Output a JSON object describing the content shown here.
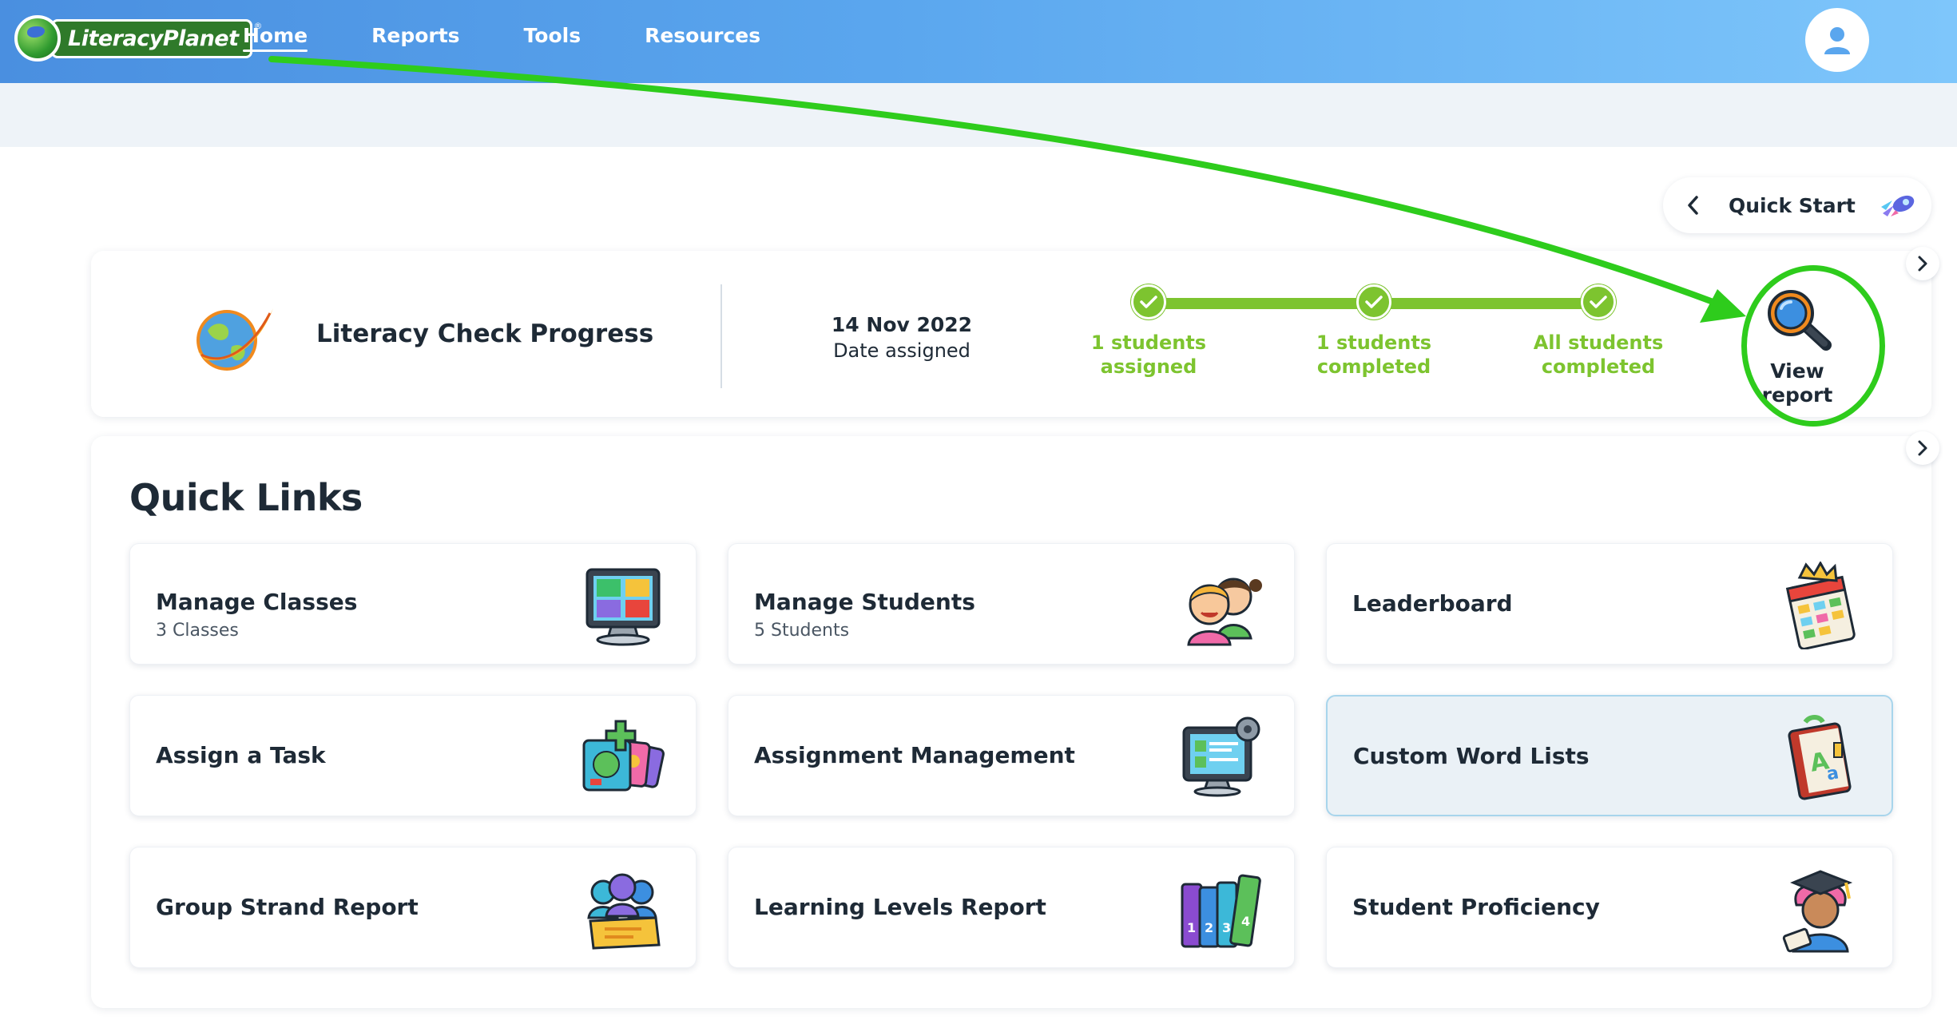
{
  "app": {
    "logo_text": "LiteracyPlanet"
  },
  "nav": {
    "items": [
      {
        "label": "Home",
        "active": true
      },
      {
        "label": "Reports",
        "active": false
      },
      {
        "label": "Tools",
        "active": false
      },
      {
        "label": "Resources",
        "active": false
      }
    ],
    "avatar_icon": "user-icon"
  },
  "quick_start": {
    "label": "Quick Start",
    "back_icon": "chevron-left-icon",
    "icon": "rocket-icon"
  },
  "progress": {
    "title": "Literacy Check Progress",
    "icon": "planet-swoosh-icon",
    "date_value": "14 Nov 2022",
    "date_label": "Date assigned",
    "steps": [
      {
        "label": "1 students assigned",
        "line1": "1 students",
        "line2": "assigned"
      },
      {
        "label": "1 students completed",
        "line1": "1 students",
        "line2": "completed"
      },
      {
        "label": "All students completed",
        "line1": "All students",
        "line2": "completed"
      }
    ],
    "step_color": "#7dc42f",
    "view_report": {
      "line1": "View",
      "line2": "report",
      "icon": "magnifier-icon"
    }
  },
  "quick_links": {
    "title": "Quick Links",
    "cards": [
      {
        "title": "Manage Classes",
        "subtitle": "3 Classes",
        "icon": "classroom-monitor-icon"
      },
      {
        "title": "Manage Students",
        "subtitle": "5 Students",
        "icon": "students-icon"
      },
      {
        "title": "Leaderboard",
        "subtitle": "",
        "icon": "leaderboard-icon"
      },
      {
        "title": "Assign a Task",
        "subtitle": "",
        "icon": "assign-task-icon"
      },
      {
        "title": "Assignment Management",
        "subtitle": "",
        "icon": "assignment-monitor-icon"
      },
      {
        "title": "Custom Word Lists",
        "subtitle": "",
        "icon": "word-list-book-icon"
      },
      {
        "title": "Group Strand Report",
        "subtitle": "",
        "icon": "group-report-icon"
      },
      {
        "title": "Learning Levels Report",
        "subtitle": "",
        "icon": "books-levels-icon"
      },
      {
        "title": "Student Proficiency",
        "subtitle": "",
        "icon": "graduate-icon"
      }
    ]
  },
  "colors": {
    "brand_blue": "#4a8fe0",
    "progress_green": "#7dc42f",
    "highlight_green": "#2ecc1c"
  }
}
